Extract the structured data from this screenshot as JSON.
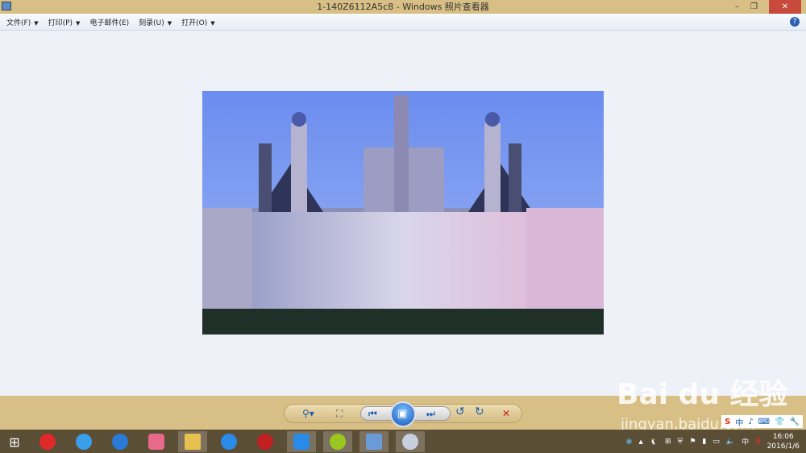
{
  "window": {
    "title": "1-140Z6112A5c8 - Windows 照片查看器",
    "minimize": "–",
    "restore": "❐",
    "close": "✕"
  },
  "menu": [
    {
      "label": "文件(F)",
      "has_arrow": true
    },
    {
      "label": "打印(P)",
      "has_arrow": true
    },
    {
      "label": "电子邮件(E)",
      "has_arrow": false
    },
    {
      "label": "刻录(U)",
      "has_arrow": true
    },
    {
      "label": "打开(O)",
      "has_arrow": true
    }
  ],
  "help": "?",
  "controls": {
    "zoom": "⚲▾",
    "fit": "⛶",
    "prev": "⏮",
    "slideshow": "▣",
    "next": "⏭",
    "rotate_ccw": "↺",
    "rotate_cw": "↻",
    "delete": "✕"
  },
  "taskbar": {
    "apps": [
      "windows-start",
      "vivaldi",
      "baidu-cloud",
      "app-blue",
      "app-pink",
      "file-explorer",
      "sogou-browser",
      "media-player",
      "app-blue2",
      "app-green",
      "photo-viewer",
      "paint"
    ]
  },
  "tray": {
    "arrow": "▲",
    "ime": "中",
    "time": "16:06",
    "date": "2016/1/6"
  },
  "watermark": {
    "brand": "Bai du 经验",
    "url": "jingyan.baidu.com"
  },
  "colors": {
    "titlebar": "#d8bf85",
    "taskbar": "#5a4e36",
    "accent": "#1c5bb4"
  }
}
